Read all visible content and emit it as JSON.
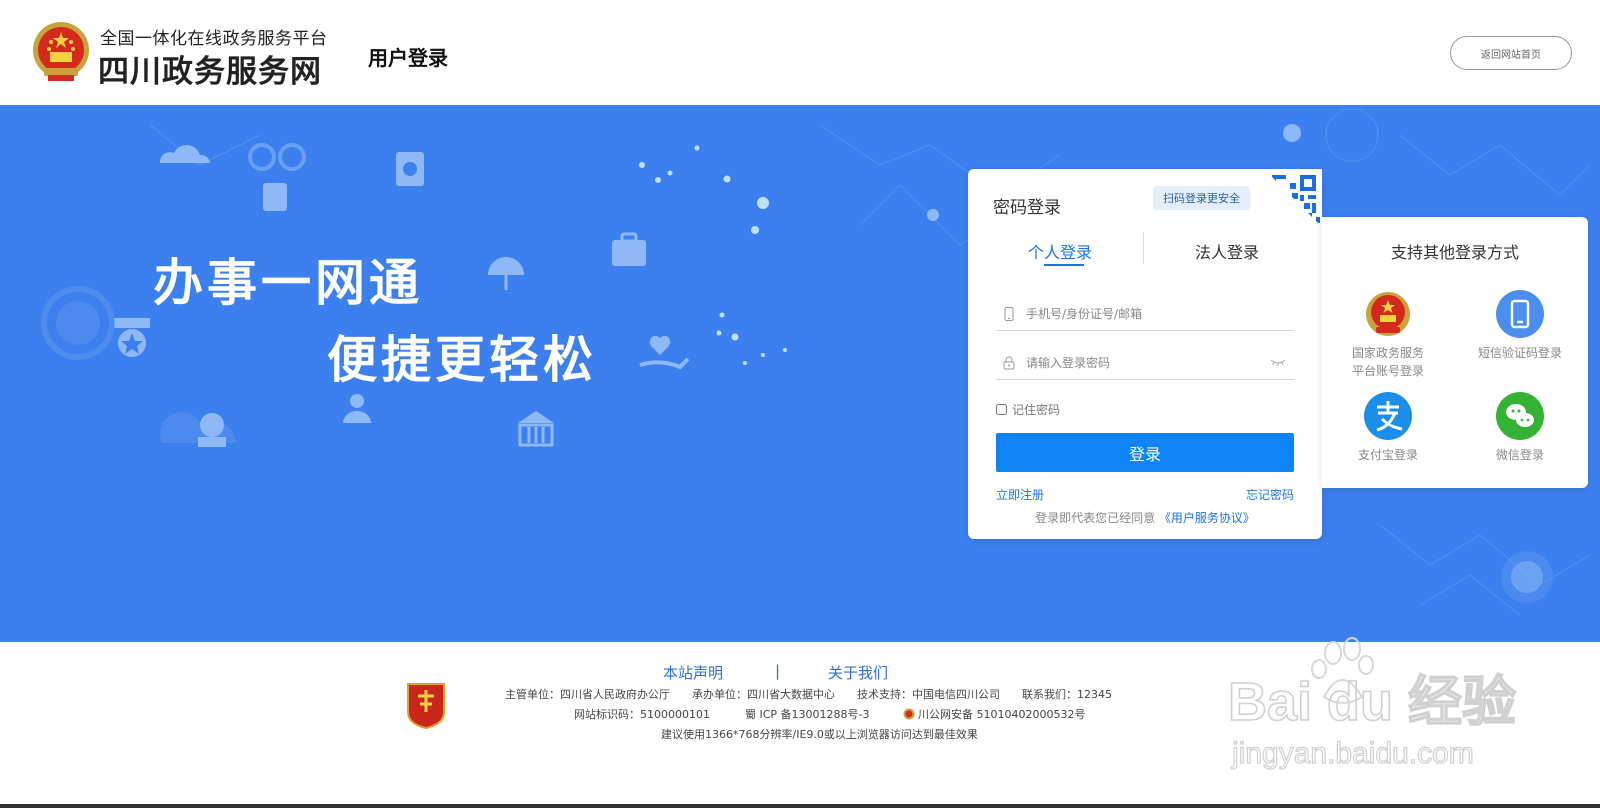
{
  "header": {
    "platform_subtitle": "全国一体化在线政务服务平台",
    "site_name": "四川政务服务网",
    "page_heading": "用户登录",
    "back_home_label": "返回网站首页"
  },
  "banner": {
    "slogan_line1": "办事一网通",
    "slogan_line2": "便捷更轻松",
    "background_color": "#3b80ee"
  },
  "login": {
    "title": "密码登录",
    "qr_tip": "扫码登录更安全",
    "tabs": [
      {
        "label": "个人登录",
        "active": true
      },
      {
        "label": "法人登录",
        "active": false
      }
    ],
    "account_placeholder": "手机号/身份证号/邮箱",
    "password_placeholder": "请输入登录密码",
    "remember_label": "记住密码",
    "submit_label": "登录",
    "register_label": "立即注册",
    "forgot_label": "忘记密码",
    "agreement_prefix": "登录即代表您已经同意",
    "agreement_link": "《用户服务协议》",
    "accent_color": "#0e84f7"
  },
  "other_methods": {
    "title": "支持其他登录方式",
    "items": [
      {
        "icon": "national-emblem-icon",
        "label_line1": "国家政务服务",
        "label_line2": "平台账号登录"
      },
      {
        "icon": "mobile-phone-icon",
        "label_line1": "短信验证码登录",
        "label_line2": ""
      },
      {
        "icon": "alipay-icon",
        "label_line1": "支付宝登录",
        "label_line2": ""
      },
      {
        "icon": "wechat-icon",
        "label_line1": "微信登录",
        "label_line2": ""
      }
    ]
  },
  "footer": {
    "link_statement": "本站声明",
    "separator": "|",
    "link_about": "关于我们",
    "line1": "主管单位：四川省人民政府办公厅　　承办单位：四川省大数据中心　　技术支持：中国电信四川公司　　联系我们：12345",
    "line2_id": "网站标识码：5100000101",
    "line2_icp": "蜀 ICP 备13001288号-3",
    "line2_police": "川公网安备 51010402000532号",
    "line3": "建议使用1366*768分辨率/IE9.0或以上浏览器访问达到最佳效果"
  },
  "watermark": {
    "text": "Bai du 经验",
    "url_text": "jingyan.baidu.com"
  }
}
